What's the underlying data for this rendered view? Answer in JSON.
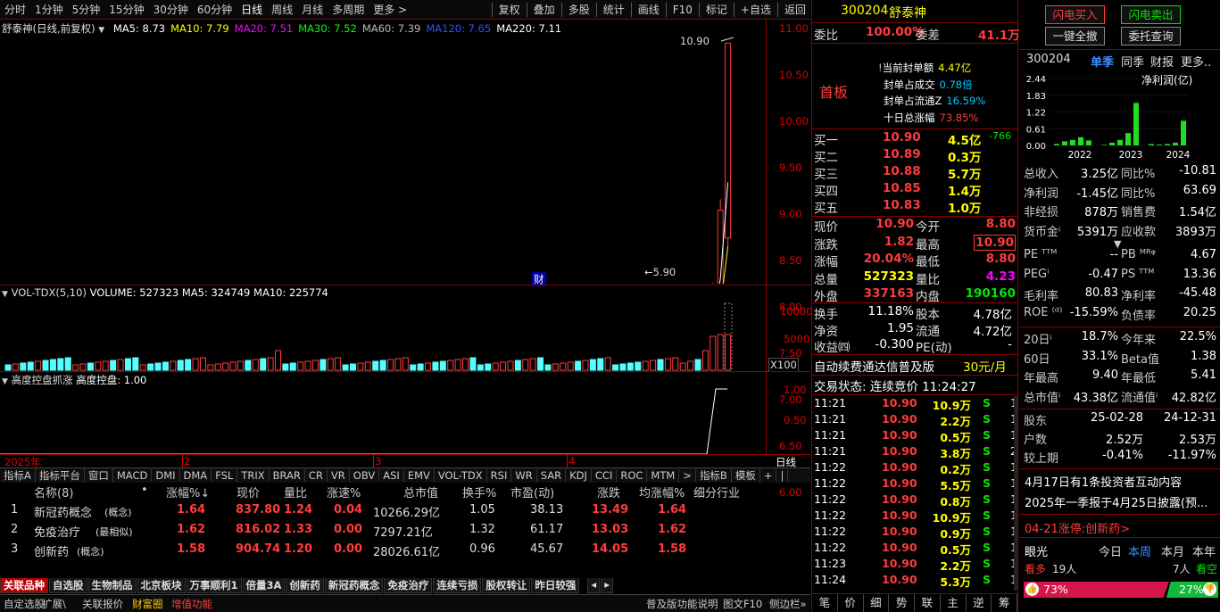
{
  "toolbar": {
    "periods": [
      "分时",
      "1分钟",
      "5分钟",
      "15分钟",
      "30分钟",
      "60分钟",
      "日线",
      "周线",
      "月线",
      "多周期",
      "更多 >"
    ],
    "tools": [
      "复权",
      "叠加",
      "多股",
      "统计",
      "画线",
      "F10",
      "标记",
      "+自选",
      "返回"
    ]
  },
  "kline": {
    "title": "舒泰神(日线,前复权)",
    "ma": [
      {
        "label": "MA5: 8.73",
        "color": "#ffffff"
      },
      {
        "label": "MA10: 7.79",
        "color": "#ffff00"
      },
      {
        "label": "MA20: 7.51",
        "color": "#ff00ff"
      },
      {
        "label": "MA30: 7.52",
        "color": "#00ff00"
      },
      {
        "label": "MA60: 7.39",
        "color": "#bbbbbb"
      },
      {
        "label": "MA120: 7.65",
        "color": "#3050ff"
      },
      {
        "label": "MA220: 7.11",
        "color": "#ffffff"
      }
    ],
    "y_ticks": [
      "11.00",
      "10.50",
      "10.00",
      "9.50",
      "9.00",
      "8.50",
      "8.00",
      "7.50",
      "7.00",
      "6.50",
      "6.00"
    ],
    "high_label": "10.90",
    "low_label": "5.90",
    "finance_mark": "财"
  },
  "volume": {
    "title": "VOL-TDX(5,10)",
    "vals": "VOLUME: 527323  MA5: 324749  MA10: 225774",
    "y_ticks": [
      "10000",
      "5000"
    ],
    "unit": "X100"
  },
  "ctrl": {
    "title": "高度控盘抓涨",
    "val": "高度控盘: 1.00",
    "y_ticks": [
      "1.00",
      "0.50"
    ]
  },
  "timeline": {
    "year": "2025年",
    "months": [
      "2",
      "3",
      "4"
    ],
    "period": "日线"
  },
  "indicator_tabs": [
    "指标A",
    "指标平台",
    "窗口",
    "MACD",
    "DMI",
    "DMA",
    "FSL",
    "TRIX",
    "BRAR",
    "CR",
    "VR",
    "OBV",
    "ASI",
    "EMV",
    "VOL-TDX",
    "RSI",
    "WR",
    "SAR",
    "KDJ",
    "CCI",
    "ROC",
    "MTM",
    ">",
    "指标B",
    "模板",
    "+",
    "|"
  ],
  "sector_table": {
    "headers": [
      "名称(8)",
      "•",
      "涨幅%↓",
      "现价",
      "量比",
      "涨速%",
      "总市值",
      "换手%",
      "市盈(动)",
      "涨跌",
      "均涨幅%",
      "细分行业"
    ],
    "rows": [
      {
        "idx": "1",
        "name": "新冠药概念",
        "tag": "(概念)",
        "chg": "1.64",
        "price": "837.80",
        "vr": "1.24",
        "spd": "0.04",
        "cap": "10266.29亿",
        "turn": "1.05",
        "pe": "38.13",
        "diff": "13.49",
        "avg": "1.64"
      },
      {
        "idx": "2",
        "name": "免疫治疗",
        "tag": "(最相似)",
        "chg": "1.62",
        "price": "816.02",
        "vr": "1.33",
        "spd": "0.00",
        "cap": "7297.21亿",
        "turn": "1.32",
        "pe": "61.17",
        "diff": "13.03",
        "avg": "1.62"
      },
      {
        "idx": "3",
        "name": "创新药",
        "tag": "(概念)",
        "chg": "1.58",
        "price": "904.74",
        "vr": "1.20",
        "spd": "0.00",
        "cap": "28026.61亿",
        "turn": "0.96",
        "pe": "45.67",
        "diff": "14.05",
        "avg": "1.58"
      }
    ]
  },
  "bottom_tabs": [
    "关联品种",
    "自选股",
    "生物制品",
    "北京板块",
    "万事顺利1",
    "倍量3A",
    "创新药",
    "新冠药概念",
    "免疫治疗",
    "连续亏损",
    "股权转让",
    "昨日较强"
  ],
  "status_left": [
    "自定选股",
    "扩展\\",
    "关联报价",
    "财富圈",
    "增值功能"
  ],
  "status_right": [
    "普及版功能说明",
    "图文F10",
    "侧边栏»"
  ],
  "quote": {
    "code": "300204",
    "name": "舒泰神",
    "weibi_label": "委比",
    "weibi": "100.00%",
    "weicha_label": "委差",
    "weicha": "41.1万",
    "first_board": "首板",
    "seal": [
      {
        "k": "当前封单额",
        "v": "4.47亿"
      },
      {
        "k": "封单占成交",
        "v": "0.78倍"
      },
      {
        "k": "封单占流通Z",
        "v": "16.59%"
      },
      {
        "k": "十日总涨幅",
        "v": "73.85%"
      }
    ],
    "bids": [
      {
        "k": "买一",
        "p": "10.90",
        "v": "4.5亿",
        "x": "-766"
      },
      {
        "k": "买二",
        "p": "10.89",
        "v": "0.3万",
        "x": ""
      },
      {
        "k": "买三",
        "p": "10.88",
        "v": "5.7万",
        "x": ""
      },
      {
        "k": "买四",
        "p": "10.85",
        "v": "1.4万",
        "x": ""
      },
      {
        "k": "买五",
        "p": "10.83",
        "v": "1.0万",
        "x": ""
      }
    ],
    "stats": [
      {
        "k1": "现价",
        "v1": "10.90",
        "k2": "今开",
        "v2": "8.80"
      },
      {
        "k1": "涨跌",
        "v1": "1.82",
        "k2": "最高",
        "v2": "10.90"
      },
      {
        "k1": "涨幅",
        "v1": "20.04%",
        "k2": "最低",
        "v2": "8.80"
      },
      {
        "k1": "总量",
        "v1": "527323",
        "k2": "量比",
        "v2": "4.23"
      },
      {
        "k1": "外盘",
        "v1": "337163",
        "k2": "内盘",
        "v2": "190160"
      }
    ],
    "stats2": [
      {
        "k1": "换手",
        "v1": "11.18%",
        "k2": "股本",
        "v2": "4.78亿"
      },
      {
        "k1": "净资",
        "v1": "1.95",
        "k2": "流通",
        "v2": "4.72亿"
      },
      {
        "k1": "收益㈣",
        "v1": "-0.300",
        "k2": "PE(动)",
        "v2": "-"
      }
    ],
    "ad": "自动续费通达信普及版",
    "ad_price": "30元/月",
    "trade_state": "交易状态: 连续竞价 11:24:27",
    "ticks": [
      {
        "t": "11:21",
        "p": "10.90",
        "v": "10.9万",
        "d": "S",
        "n": "1"
      },
      {
        "t": "11:21",
        "p": "10.90",
        "v": "2.2万",
        "d": "S",
        "n": "1"
      },
      {
        "t": "11:21",
        "p": "10.90",
        "v": "0.5万",
        "d": "S",
        "n": "1"
      },
      {
        "t": "11:21",
        "p": "10.90",
        "v": "3.8万",
        "d": "S",
        "n": "2"
      },
      {
        "t": "11:22",
        "p": "10.90",
        "v": "0.2万",
        "d": "S",
        "n": "1"
      },
      {
        "t": "11:22",
        "p": "10.90",
        "v": "5.5万",
        "d": "S",
        "n": "1"
      },
      {
        "t": "11:22",
        "p": "10.90",
        "v": "0.8万",
        "d": "S",
        "n": "1"
      },
      {
        "t": "11:22",
        "p": "10.90",
        "v": "10.9万",
        "d": "S",
        "n": "1"
      },
      {
        "t": "11:22",
        "p": "10.90",
        "v": "0.9万",
        "d": "S",
        "n": "1"
      },
      {
        "t": "11:22",
        "p": "10.90",
        "v": "0.5万",
        "d": "S",
        "n": "1"
      },
      {
        "t": "11:23",
        "p": "10.90",
        "v": "2.2万",
        "d": "S",
        "n": "1"
      },
      {
        "t": "11:24",
        "p": "10.90",
        "v": "5.3万",
        "d": "S",
        "n": "1"
      }
    ],
    "bottom_nav": [
      "笔",
      "价",
      "细",
      "势",
      "联",
      "主",
      "逆",
      "筹"
    ]
  },
  "right": {
    "buttons": [
      "闪电买入",
      "闪电卖出",
      "一键全撤",
      "委托查询"
    ],
    "code": "300204",
    "tabs": [
      "单季",
      "同季",
      "财报",
      "更多.."
    ],
    "chart_label": "净利润(亿)",
    "bar_ticks": [
      "2.44",
      "1.83",
      "1.22",
      "0.61",
      "0.00"
    ],
    "years": [
      "2022",
      "2023",
      "2024"
    ],
    "bars": [
      0.05,
      0.15,
      0.2,
      0.3,
      0.18,
      0.02,
      0.1,
      0.2,
      0.45,
      1.55,
      0.05,
      0.03,
      0.05,
      0.1,
      0.9
    ],
    "fin": [
      {
        "k1": "总收入",
        "v1": "3.25亿",
        "k2": "同比%",
        "v2": "-10.81"
      },
      {
        "k1": "净利润",
        "v1": "-1.45亿",
        "k2": "同比%",
        "v2": "63.69"
      },
      {
        "k1": "非经损",
        "v1": "878万",
        "k2": "销售费",
        "v2": "1.54亿"
      },
      {
        "k1": "货币金ⁱ",
        "v1": "5391万",
        "k2": "应收款",
        "v2": "3893万"
      }
    ],
    "val": [
      {
        "k1": "PE ᵀᵀᴹ",
        "v1": "--",
        "k2": "PB ᴹᴿᵠ",
        "v2": "4.67"
      },
      {
        "k1": "PEGⁱ",
        "v1": "-0.47",
        "k2": "PS ᵀᵀᴹ",
        "v2": "13.36"
      },
      {
        "k1": "毛利率",
        "v1": "80.83",
        "k2": "净利率",
        "v2": "-45.48"
      },
      {
        "k1": "ROE ⁽ᵈ⁾",
        "v1": "-15.59%",
        "k2": "负债率",
        "v2": "20.25"
      }
    ],
    "perf": [
      {
        "k1": "20日ⁱ",
        "v1": "18.7%",
        "k2": "今年来",
        "v2": "22.5%"
      },
      {
        "k1": "60日",
        "v1": "33.1%",
        "k2": "Beta值",
        "v2": "1.38"
      },
      {
        "k1": "年最高",
        "v1": "9.40",
        "k2": "年最低",
        "v2": "5.41"
      },
      {
        "k1": "总市值ⁱ",
        "v1": "43.38亿",
        "k2": "流通值ⁱ",
        "v2": "42.82亿"
      }
    ],
    "holders": [
      {
        "k": "股东",
        "a": "25-02-28",
        "b": "24-12-31"
      },
      {
        "k": "户数",
        "a": "2.52万",
        "b": "2.53万"
      },
      {
        "k": "较上期",
        "a": "-0.41%",
        "b": "-11.97%"
      }
    ],
    "news": [
      "4月17日有1条投资者互动内容",
      "2025年一季报于4月25日披露(预..."
    ],
    "limit_news": "04-21涨停:创新药>",
    "eye": {
      "label": "眼光",
      "tabs": [
        "今日",
        "本周",
        "本月",
        "本年"
      ],
      "bull": "看多",
      "bull_n": "19人",
      "bear_n": "7人",
      "bear": "看空",
      "bull_pct": "73%",
      "bear_pct": "27%"
    }
  }
}
